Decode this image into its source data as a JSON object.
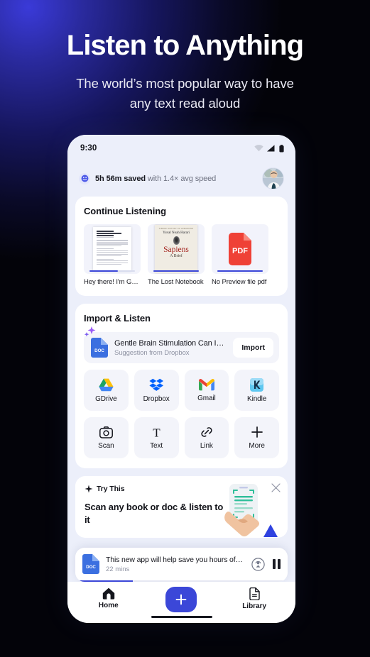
{
  "hero": {
    "title": "Listen to Anything",
    "subtitle_line1": "The world’s most popular way to have",
    "subtitle_line2": "any text read aloud"
  },
  "colors": {
    "accent_blue": "#3b47d8",
    "pdf_red": "#ef4136",
    "app_bg": "#eceffa",
    "card_bg": "#ffffff",
    "tile_bg": "#f3f4fa",
    "sparkle_purple": "#9b5cf6"
  },
  "phone": {
    "status_bar": {
      "time": "9:30",
      "icons": [
        "wifi-icon",
        "cellular-signal-icon",
        "battery-icon"
      ]
    },
    "saved_banner": {
      "icon": "smiley-icon",
      "bold_text": "5h 56m saved",
      "rest_text": " with 1.4× avg speed",
      "avatar": "user-avatar"
    },
    "continue_listening": {
      "title": "Continue Listening",
      "items": [
        {
          "label": "Hey there! I'm Gwyn…",
          "thumb": "document-page-thumbnail",
          "progress_pct": 62
        },
        {
          "label": "The Lost Notebook",
          "thumb": "sapiens-book-cover",
          "progress_pct": 100,
          "cover": {
            "top_line": "A BRIEF HISTORY OF HUMANKIND",
            "author": "Yuval Noah Harari",
            "title": "Sapiens",
            "subtitle": "A Brief"
          }
        },
        {
          "label": "No Preview file pdf",
          "thumb": "pdf-file-icon",
          "progress_pct": 100,
          "badge": "PDF"
        }
      ]
    },
    "import_listen": {
      "title": "Import & Listen",
      "suggestion": {
        "icon": "doc-file-icon",
        "badge": "DOC",
        "title": "Gentle Brain Stimulation Can I…",
        "subtitle": "Suggestion from Dropbox",
        "button": "Import",
        "sparkle": "sparkle-icon"
      },
      "sources": [
        {
          "label": "GDrive",
          "icon": "google-drive-icon"
        },
        {
          "label": "Dropbox",
          "icon": "dropbox-icon"
        },
        {
          "label": "Gmail",
          "icon": "gmail-icon"
        },
        {
          "label": "Kindle",
          "icon": "kindle-icon"
        }
      ],
      "actions": [
        {
          "label": "Scan",
          "icon": "camera-icon"
        },
        {
          "label": "Text",
          "icon": "text-t-icon"
        },
        {
          "label": "Link",
          "icon": "link-icon"
        },
        {
          "label": "More",
          "icon": "plus-icon"
        }
      ]
    },
    "try_this": {
      "eyebrow": "Try This",
      "eyebrow_icon": "sparkle-icon",
      "title": "Scan any book or doc & listen to it",
      "close_icon": "close-icon",
      "illustration": "hand-holding-phone-scanning-illustration"
    },
    "player": {
      "icon": "doc-file-icon",
      "badge": "DOC",
      "title": "This new app will help save you hours of…",
      "duration": "22 mins",
      "cast_icon": "cast-icon",
      "pause_icon": "pause-icon",
      "progress_pct": 27
    },
    "bottom_nav": {
      "items": [
        {
          "label": "Home",
          "icon": "home-icon",
          "active": true
        },
        {
          "label": "Library",
          "icon": "library-document-icon",
          "active": false
        }
      ],
      "fab": {
        "icon": "plus-icon",
        "label": "Add"
      },
      "home_indicator": "home-indicator-bar"
    }
  }
}
